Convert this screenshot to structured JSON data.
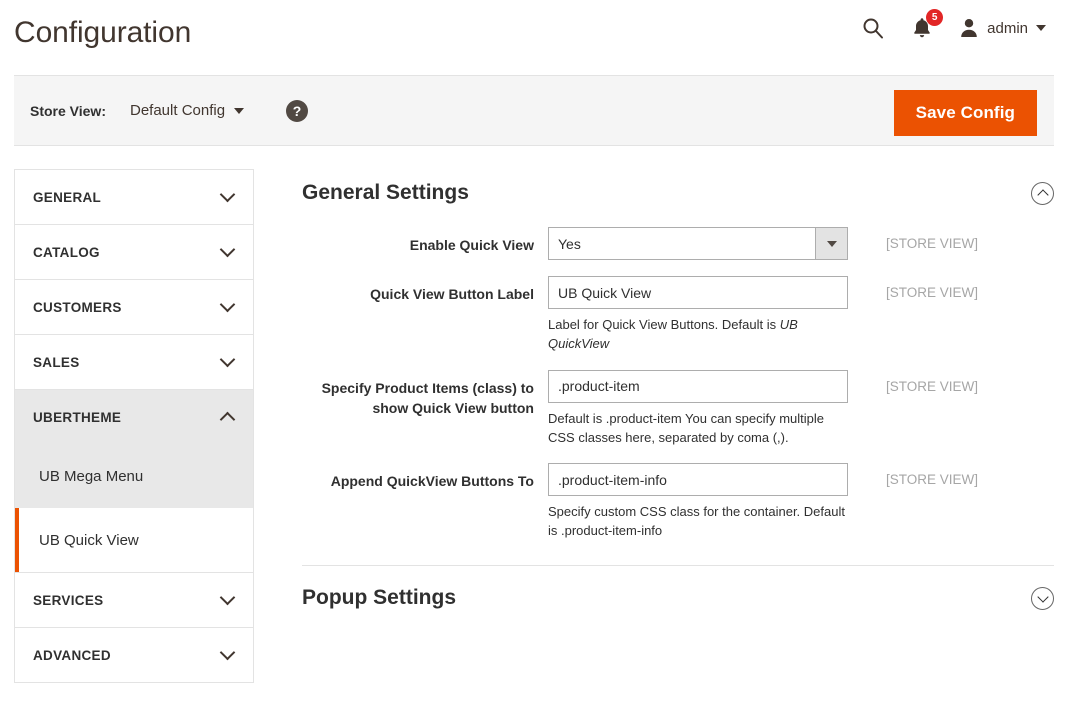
{
  "header": {
    "title": "Configuration",
    "search_icon": "search-icon",
    "notifications_icon": "bell-icon",
    "notifications_count": "5",
    "user_icon": "user-icon",
    "user_name": "admin"
  },
  "storeview_bar": {
    "label": "Store View:",
    "selected": "Default Config",
    "help_icon": "?",
    "save_button": "Save Config"
  },
  "sidebar": {
    "sections": [
      {
        "label": "GENERAL",
        "expanded": false
      },
      {
        "label": "CATALOG",
        "expanded": false
      },
      {
        "label": "CUSTOMERS",
        "expanded": false
      },
      {
        "label": "SALES",
        "expanded": false
      },
      {
        "label": "UBERTHEME",
        "expanded": true
      },
      {
        "label": "SERVICES",
        "expanded": false
      },
      {
        "label": "ADVANCED",
        "expanded": false
      }
    ],
    "ubertheme_items": [
      {
        "label": "UB Mega Menu",
        "active": false
      },
      {
        "label": "UB Quick View",
        "active": true
      }
    ]
  },
  "main": {
    "general_settings": {
      "title": "General Settings",
      "collapse_icon": "chevron-up-circle-icon",
      "fields": [
        {
          "label": "Enable Quick View",
          "type": "select",
          "value": "Yes",
          "note": "",
          "note_em": "",
          "note_tail": "",
          "scope": "[STORE VIEW]"
        },
        {
          "label": "Quick View Button Label",
          "type": "text",
          "value": "UB Quick View",
          "note": "Label for Quick View Buttons. Default is ",
          "note_em": "UB QuickView",
          "note_tail": "",
          "scope": "[STORE VIEW]"
        },
        {
          "label": "Specify Product Items (class) to show Quick View button",
          "type": "text",
          "value": ".product-item",
          "note": "Default is .product-item You can specify multiple CSS classes here, separated by coma (,).",
          "note_em": "",
          "note_tail": "",
          "scope": "[STORE VIEW]"
        },
        {
          "label": "Append QuickView Buttons To",
          "type": "text",
          "value": ".product-item-info",
          "note": "Specify custom CSS class for the container. Default is .product-item-info",
          "note_em": "",
          "note_tail": "",
          "scope": "[STORE VIEW]"
        }
      ]
    },
    "popup_settings": {
      "title": "Popup Settings",
      "expand_icon": "chevron-down-circle-icon"
    }
  },
  "colors": {
    "accent_orange": "#eb5202",
    "badge_red": "#e22626",
    "bar_grey": "#f5f5f5",
    "nav_active_grey": "#e8e8e8"
  }
}
